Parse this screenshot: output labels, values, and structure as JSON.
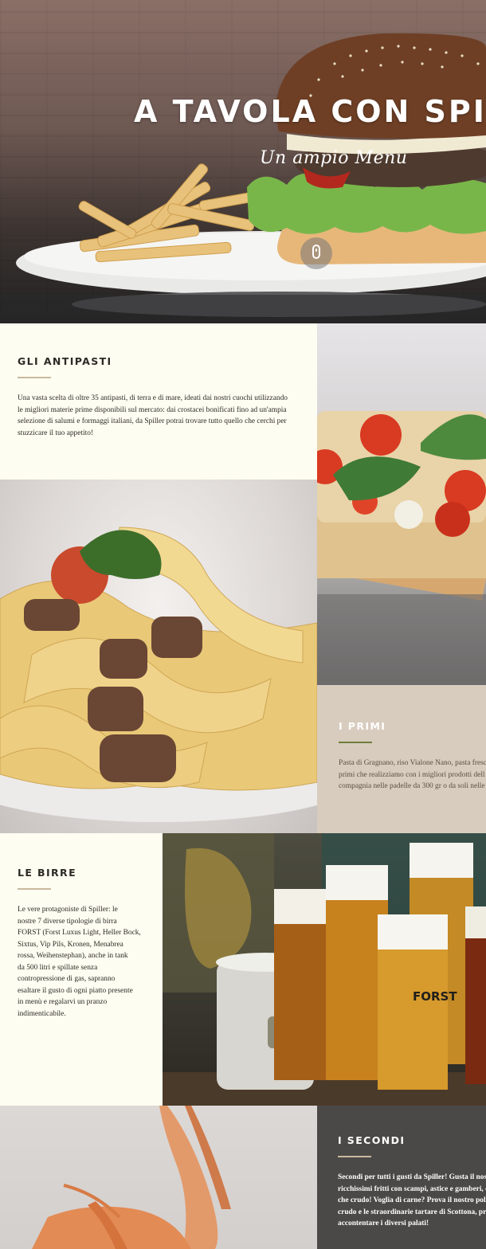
{
  "hero": {
    "title": "A TAVOLA CON SPILLER",
    "subtitle": "Un ampio Menu"
  },
  "sections": {
    "antipasti": {
      "title": "GLI ANTIPASTI",
      "text": "Una vasta scelta di oltre 35 antipasti, di terra e di mare, ideati dai nostri cuochi utilizzando le migliori materie prime disponibili sul mercato: dai crostacei bonificati fino ad un'ampia selezione di salumi e formaggi italiani, da Spiller potrai trovare tutto quello che cerchi per stuzzicare il tuo appetito!",
      "lines": [
        "Una vasta scelta di oltre 35 antipasti, di terra e di mare, ideati dai nostri cuochi utilizzando",
        "le migliori materie prime disponibili sul mercato: dai crostacei bonificati fino ad un'ampia",
        "selezione di salumi e formaggi italiani, da Spiller potrai trovare tutto quello che cerchi per",
        "stuzzicare il tuo appetito!"
      ]
    },
    "primi": {
      "title": "I PRIMI",
      "lines": [
        "Pasta di Gragnano, riso Vialone Nano, pasta fresca",
        "primi che realizziamo con i migliori prodotti dell",
        "compagnia nelle padelle da 300 gr o da soli nelle"
      ]
    },
    "birre": {
      "title": "LE BIRRE",
      "lines": [
        "Le vere protagoniste di Spiller: le",
        "nostre 7 diverse tipologie di birra",
        "FORST (Forst Luxus Light, Heller Bock,",
        "Sixtus, Vip Pils, Kronen, Menabrea",
        "rossa, Weihenstephan), anche in tank",
        "da 500 litri e spillate senza",
        "contropressione di gas, sapranno",
        "esaltare il gusto di ogni piatto presente",
        "in menù e regalarvi un pranzo",
        "indimenticabile."
      ]
    },
    "secondi": {
      "title": "I SECONDI",
      "lines": [
        "Secondi per tutti i gusti da Spiller! Gusta il nostro",
        "ricchissimi fritti con scampi, astice e gamberi, o",
        "che crudo! Voglia di carne? Prova il nostro pollo, l",
        "crudo e le straordinarie tartare di Scottona, prepa",
        "accontentare i diversi palati!"
      ]
    }
  },
  "beer_brand": "FORST",
  "colors": {
    "cream": "#fdfdf1",
    "beige": "#d8ccbe",
    "charcoal": "#4b4947",
    "olive_rule": "#6f7d3d",
    "tan_rule": "#c9b99d"
  }
}
